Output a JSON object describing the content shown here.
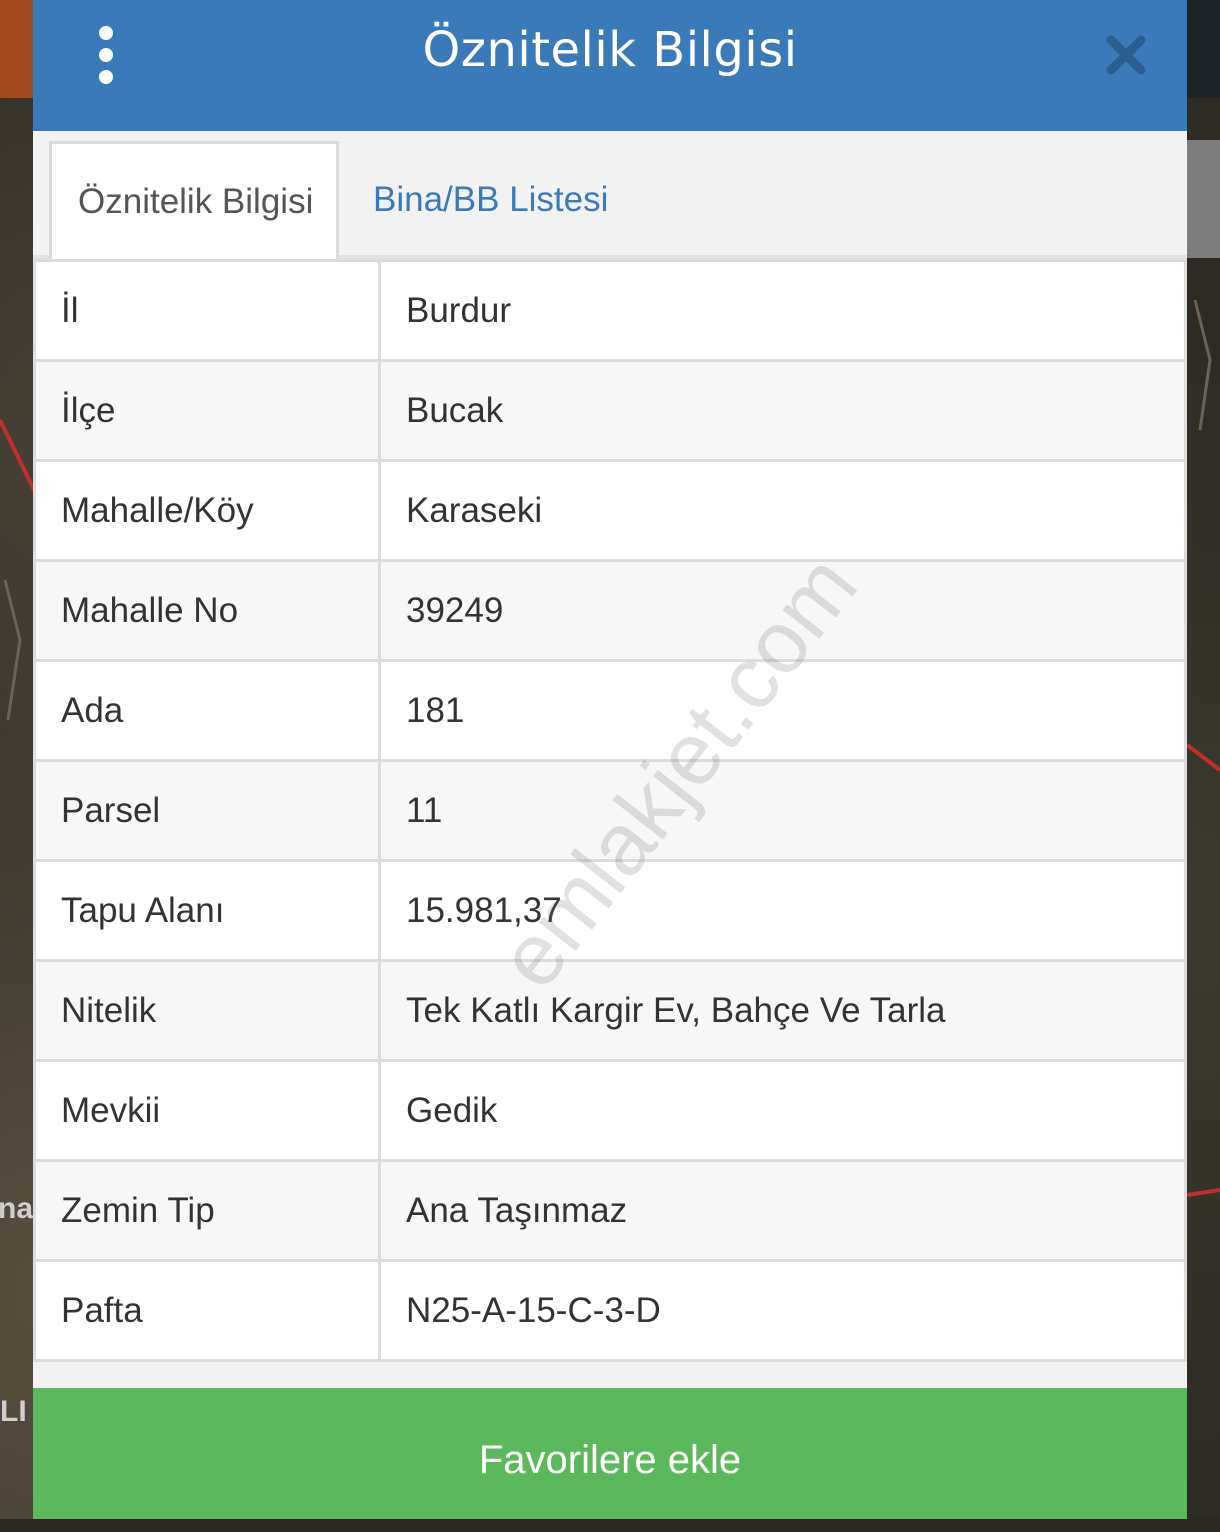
{
  "dialog": {
    "title": "Öznitelik Bilgisi"
  },
  "tabs": [
    {
      "label": "Öznitelik Bilgisi",
      "active": true
    },
    {
      "label": "Bina/BB Listesi",
      "active": false
    }
  ],
  "attributes": [
    {
      "key": "İl",
      "value": "Burdur"
    },
    {
      "key": "İlçe",
      "value": "Bucak"
    },
    {
      "key": "Mahalle/Köy",
      "value": "Karaseki"
    },
    {
      "key": "Mahalle No",
      "value": "39249"
    },
    {
      "key": "Ada",
      "value": "181"
    },
    {
      "key": "Parsel",
      "value": "11"
    },
    {
      "key": "Tapu Alanı",
      "value": "15.981,37"
    },
    {
      "key": "Nitelik",
      "value": "Tek Katlı Kargir Ev, Bahçe Ve Tarla"
    },
    {
      "key": "Mevkii",
      "value": "Gedik"
    },
    {
      "key": "Zemin Tip",
      "value": "Ana Taşınmaz"
    },
    {
      "key": "Pafta",
      "value": "N25-A-15-C-3-D"
    }
  ],
  "footer": {
    "favorite_label": "Favorilere ekle"
  },
  "watermark": "emlakjet.com",
  "map_labels": {
    "left_mid": "na",
    "left_bottom": "LI"
  },
  "icons": {
    "menu": "more-vertical-icon",
    "close": "close-icon"
  },
  "colors": {
    "header": "#3a7ab8",
    "link_tab": "#3a7ab8",
    "favorite_button": "#5cb85c",
    "close_icon": "#2b5f91"
  }
}
